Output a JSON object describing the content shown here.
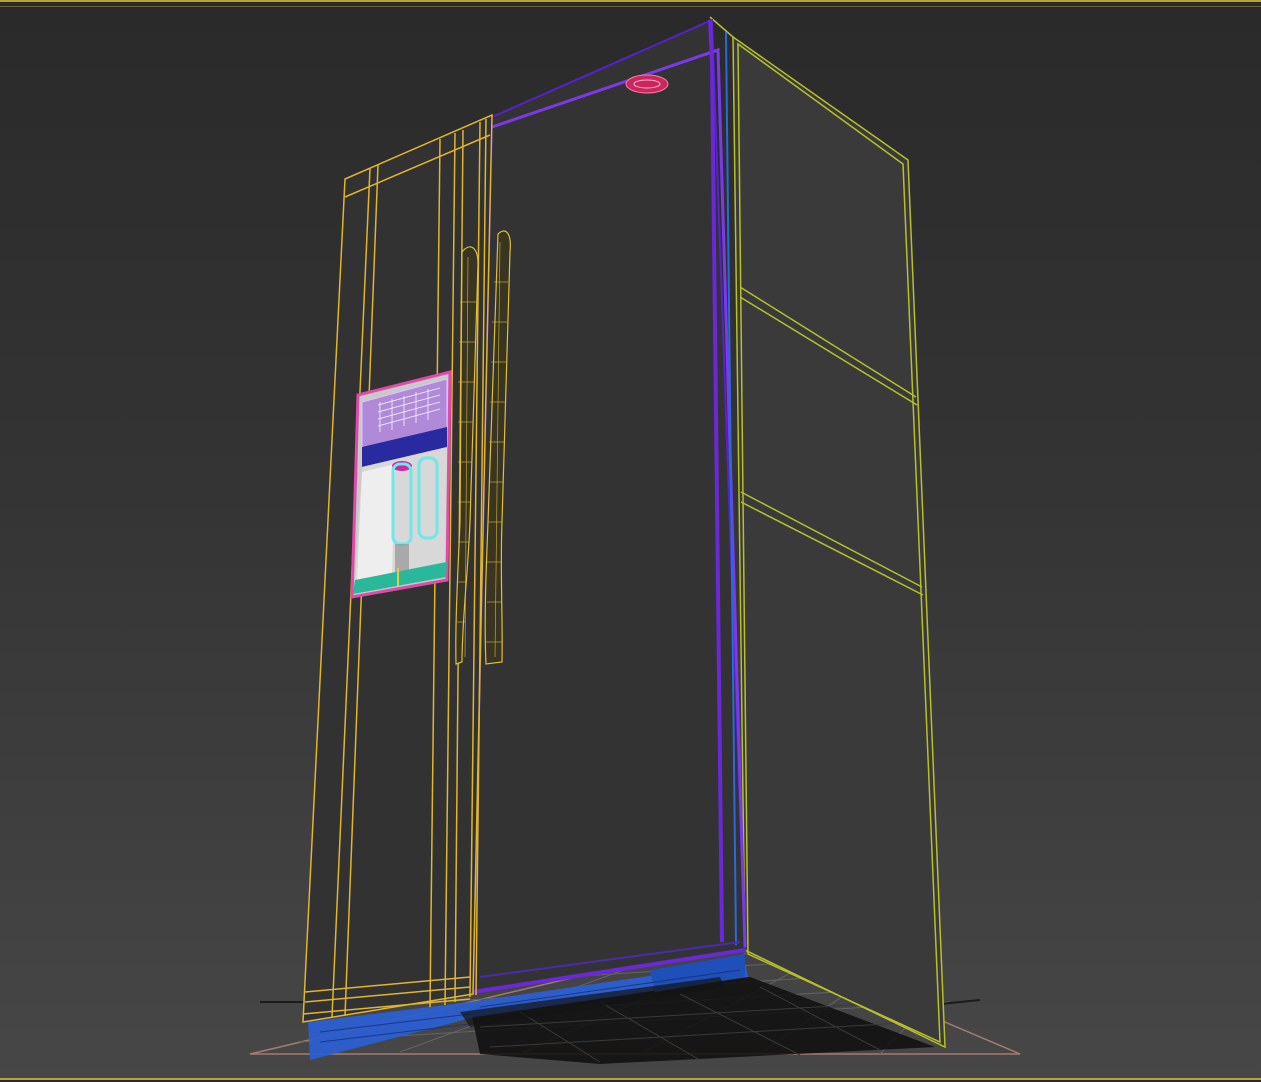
{
  "viewport": {
    "colors": {
      "background_top": "#2a2a2a",
      "background_bottom": "#474747",
      "border": "#b8a23c",
      "wire_yellow": "#e0b52f",
      "wire_olive": "#b7c02a",
      "wire_purple": "#6a28d8",
      "wire_blue": "#2a6ad8",
      "dispenser_pink": "#e04aa8",
      "dispenser_cyan": "#5ee0e0",
      "dispenser_teal": "#2ab89a",
      "base_blue": "#2b5fd0",
      "grid": "#6a6a6a",
      "brand_badge": "#d8306a"
    },
    "objects": [
      {
        "name": "freezer-door",
        "icon": "wireframe"
      },
      {
        "name": "fridge-door",
        "icon": "wireframe"
      },
      {
        "name": "cabinet-body",
        "icon": "wireframe"
      },
      {
        "name": "ice-water-dispenser",
        "icon": "textured-mesh"
      },
      {
        "name": "door-handles",
        "icon": "wireframe"
      },
      {
        "name": "base-grille",
        "icon": "mesh"
      },
      {
        "name": "ground-grid",
        "icon": "grid"
      }
    ]
  }
}
